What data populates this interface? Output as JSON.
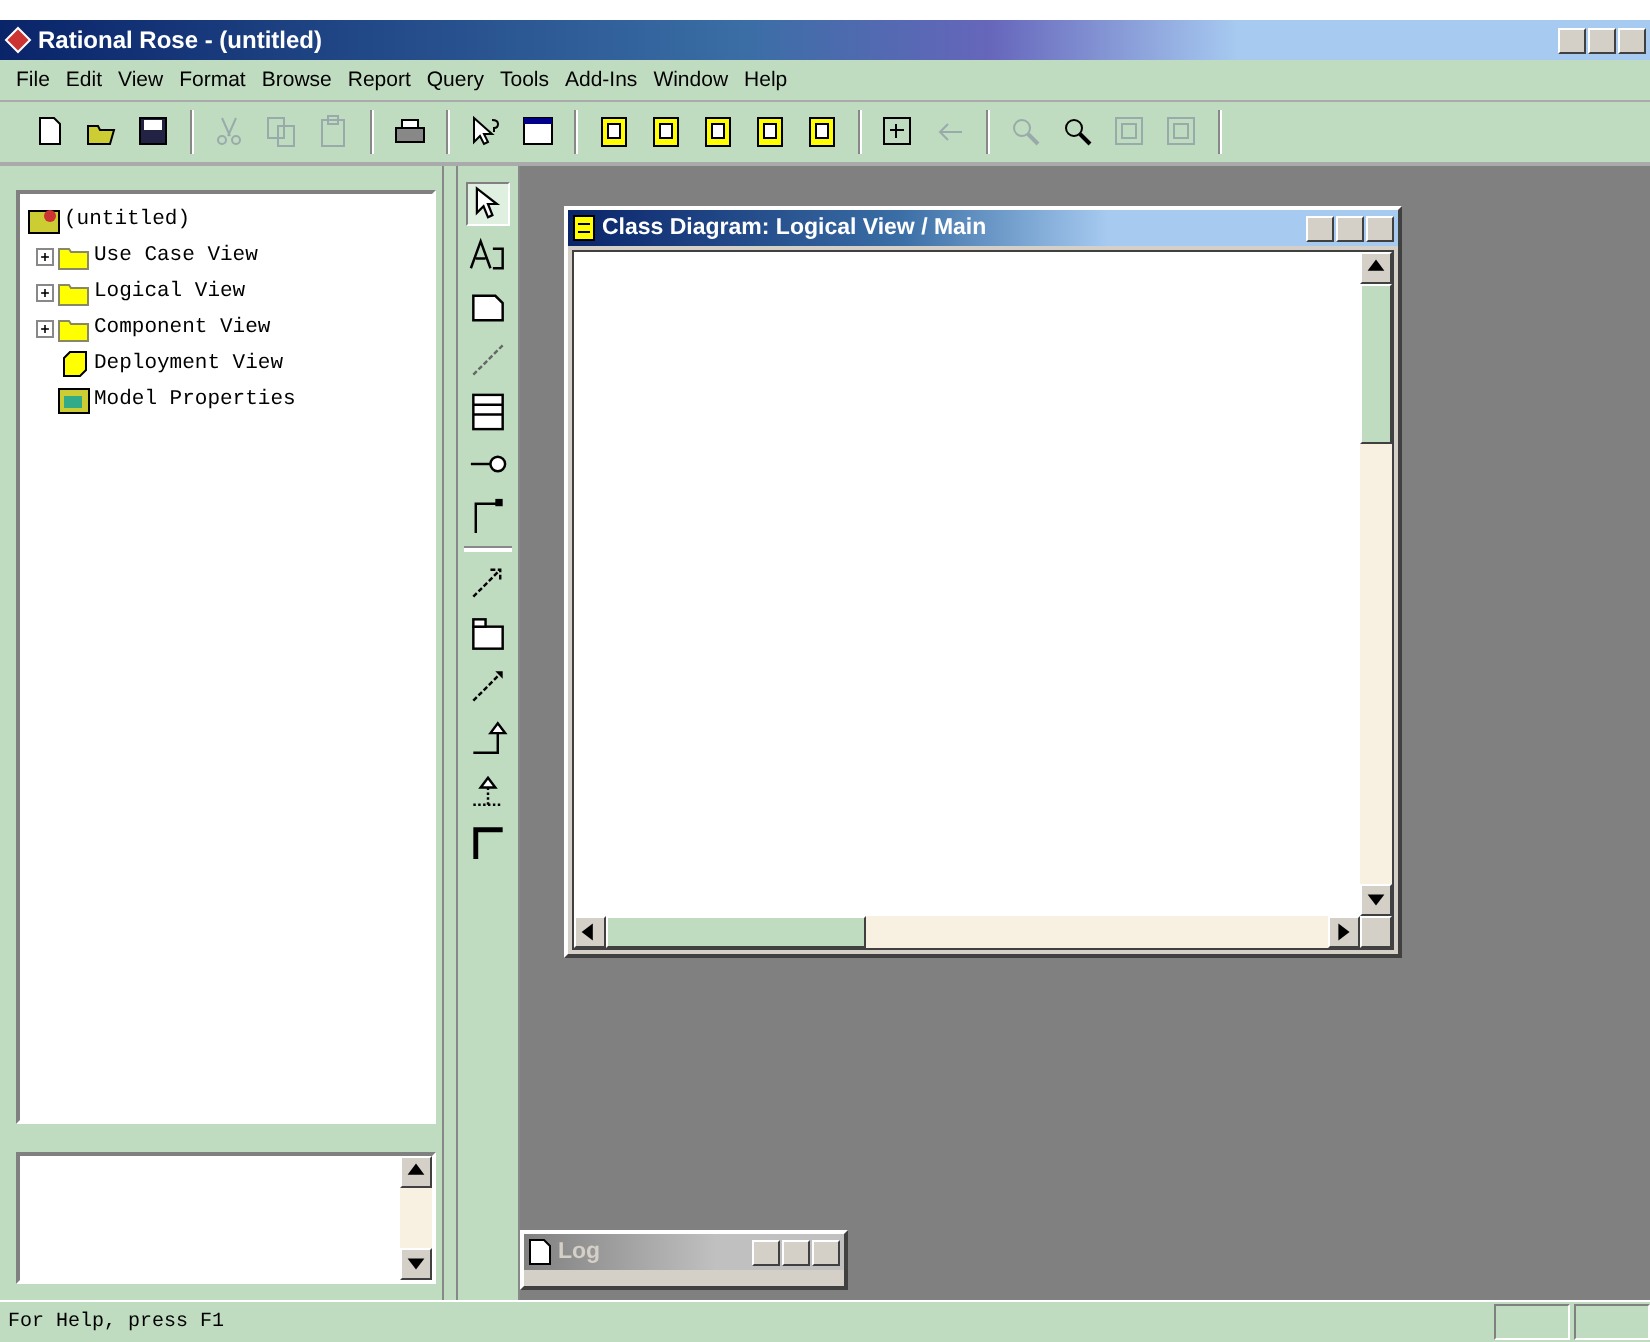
{
  "window": {
    "title": "Rational Rose - (untitled)"
  },
  "menu": [
    "File",
    "Edit",
    "View",
    "Format",
    "Browse",
    "Report",
    "Query",
    "Tools",
    "Add-Ins",
    "Window",
    "Help"
  ],
  "browser": {
    "root": "(untitled)",
    "children": [
      {
        "label": "Use Case View",
        "kind": "folder",
        "expanded": false
      },
      {
        "label": "Logical View",
        "kind": "folder",
        "expanded": false
      },
      {
        "label": "Component View",
        "kind": "folder",
        "expanded": false
      },
      {
        "label": "Deployment View",
        "kind": "deployment"
      },
      {
        "label": "Model Properties",
        "kind": "properties"
      }
    ]
  },
  "toolbox": [
    {
      "selected": true
    },
    {
      "selected": false
    },
    {
      "selected": false
    },
    {
      "selected": false
    },
    {
      "selected": false
    },
    {
      "selected": false
    },
    {
      "selected": false
    },
    {
      "selected": false
    },
    {
      "selected": false
    },
    {
      "selected": false
    },
    {
      "selected": false
    },
    {
      "selected": false
    },
    {
      "selected": false
    }
  ],
  "diagram_window": {
    "title": "Class Diagram: Logical View / Main"
  },
  "log_window": {
    "title": "Log"
  },
  "status_bar": {
    "text": "For Help, press F1"
  }
}
